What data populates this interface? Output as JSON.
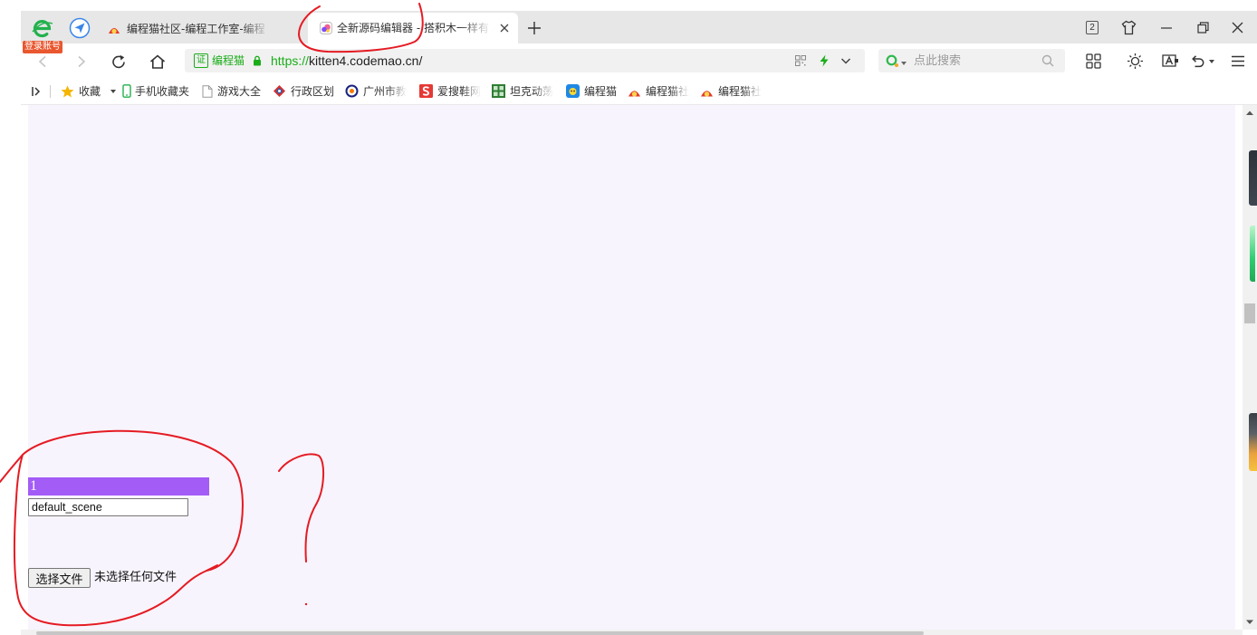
{
  "browser": {
    "brand_icon": "browser-logo-icon",
    "login_badge": "登录账号",
    "tabs": [
      {
        "label": "编程猫社区-编程工作室-编程",
        "icon": "codemao-cat-icon",
        "active": false
      },
      {
        "label": "全新源码编辑器 - 搭积木一样有",
        "icon": "kitten-editor-icon",
        "active": true
      }
    ],
    "tab_counter": "2",
    "address": {
      "cert_badge": "证",
      "site_name": "编程猫",
      "url_scheme": "https://",
      "url_rest": "kitten4.codemao.cn/"
    },
    "search": {
      "placeholder": "点此搜索"
    },
    "bookmarks": [
      {
        "label": "收藏",
        "icon": "star-icon"
      },
      {
        "label": "手机收藏夹",
        "icon": "phone-icon"
      },
      {
        "label": "游戏大全",
        "icon": "page-icon"
      },
      {
        "label": "行政区划",
        "icon": "site-icon"
      },
      {
        "label": "广州市教",
        "icon": "site-icon"
      },
      {
        "label": "爱搜鞋网",
        "icon": "s-logo-icon"
      },
      {
        "label": "坦克动荡",
        "icon": "tank-game-icon"
      },
      {
        "label": "编程猫",
        "icon": "codemao-icon"
      },
      {
        "label": "编程猫社",
        "icon": "codemao-cat-icon"
      },
      {
        "label": "编程猫社",
        "icon": "codemao-cat-icon"
      }
    ]
  },
  "page": {
    "scene_index": "1",
    "scene_name": "default_scene",
    "file_button": "选择文件",
    "file_status": "未选择任何文件"
  },
  "colors": {
    "accent_purple": "#a35cf6",
    "page_background": "#f8f4fd",
    "secure_green": "#1aad19",
    "annotation_red": "#e51b23"
  }
}
